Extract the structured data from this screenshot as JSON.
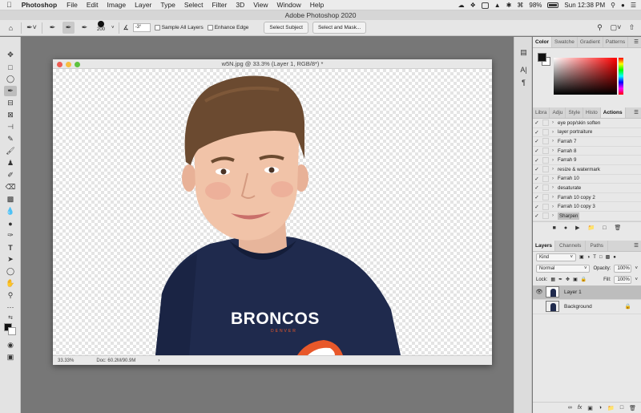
{
  "menubar": {
    "app_name": "Photoshop",
    "items": [
      "File",
      "Edit",
      "Image",
      "Layer",
      "Type",
      "Select",
      "Filter",
      "3D",
      "View",
      "Window",
      "Help"
    ],
    "battery": "98%",
    "clock": "Sun 12:38 PM"
  },
  "app_title": "Adobe Photoshop 2020",
  "options": {
    "brush_size": "200",
    "angle": "-3°",
    "sample_all_layers": "Sample All Layers",
    "enhance_edge": "Enhance Edge",
    "select_subject": "Select Subject",
    "select_and_mask": "Select and Mask..."
  },
  "document": {
    "title": "w5N.jpg @ 33.3% (Layer 1, RGB/8*) *",
    "zoom": "33.33%",
    "doc_size": "Doc: 60.2M/90.9M",
    "shirt_text": "BRONCOS",
    "shirt_subtext": "DENVER"
  },
  "color_panel": {
    "tabs": [
      "Color",
      "Swatche",
      "Gradient",
      "Patterns"
    ]
  },
  "actions_panel": {
    "tabs": [
      "Libra",
      "Adju",
      "Style",
      "Histo",
      "Actions"
    ],
    "items": [
      {
        "label": "eye pop/skin soften",
        "selected": false
      },
      {
        "label": "layer portraiture",
        "selected": false
      },
      {
        "label": "Farrah 7",
        "selected": false
      },
      {
        "label": "Farrah 8",
        "selected": false
      },
      {
        "label": "Farrah 9",
        "selected": false
      },
      {
        "label": "resize & watermark",
        "selected": false
      },
      {
        "label": "Farrah 10",
        "selected": false
      },
      {
        "label": "desaturate",
        "selected": false
      },
      {
        "label": "Farrah 10 copy 2",
        "selected": false
      },
      {
        "label": "Farrah 10 copy 3",
        "selected": false
      },
      {
        "label": "Sharpen",
        "selected": true
      }
    ]
  },
  "layers_panel": {
    "tabs": [
      "Layers",
      "Channels",
      "Paths"
    ],
    "kind": "Kind",
    "blend_mode": "Normal",
    "opacity_label": "Opacity:",
    "opacity": "100%",
    "lock_label": "Lock:",
    "fill_label": "Fill:",
    "fill": "100%",
    "layers": [
      {
        "name": "Layer 1",
        "selected": true
      },
      {
        "name": "Background",
        "selected": false
      }
    ]
  },
  "colors": {
    "fg": "#111111",
    "bg": "#ffffff",
    "shirt": "#1f2a4d",
    "accent_orange": "#e8582a"
  }
}
